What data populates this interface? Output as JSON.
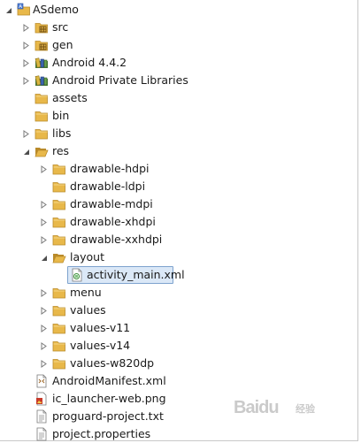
{
  "tree": {
    "nodes": [
      {
        "label": "ASdemo",
        "depth": 0,
        "toggle": "expanded",
        "icon": "project-icon",
        "selected": false
      },
      {
        "label": "src",
        "depth": 1,
        "toggle": "collapsed",
        "icon": "source-folder-icon",
        "selected": false
      },
      {
        "label": "gen",
        "depth": 1,
        "toggle": "collapsed",
        "icon": "source-folder-icon",
        "selected": false
      },
      {
        "label": "Android 4.4.2",
        "depth": 1,
        "toggle": "collapsed",
        "icon": "library-icon",
        "selected": false
      },
      {
        "label": "Android Private Libraries",
        "depth": 1,
        "toggle": "collapsed",
        "icon": "library-icon",
        "selected": false
      },
      {
        "label": "assets",
        "depth": 1,
        "toggle": "none",
        "icon": "folder-icon",
        "selected": false
      },
      {
        "label": "bin",
        "depth": 1,
        "toggle": "none",
        "icon": "folder-icon",
        "selected": false
      },
      {
        "label": "libs",
        "depth": 1,
        "toggle": "collapsed",
        "icon": "folder-icon",
        "selected": false
      },
      {
        "label": "res",
        "depth": 1,
        "toggle": "expanded",
        "icon": "open-folder-icon",
        "selected": false
      },
      {
        "label": "drawable-hdpi",
        "depth": 2,
        "toggle": "collapsed",
        "icon": "folder-icon",
        "selected": false
      },
      {
        "label": "drawable-ldpi",
        "depth": 2,
        "toggle": "none",
        "icon": "folder-icon",
        "selected": false
      },
      {
        "label": "drawable-mdpi",
        "depth": 2,
        "toggle": "collapsed",
        "icon": "folder-icon",
        "selected": false
      },
      {
        "label": "drawable-xhdpi",
        "depth": 2,
        "toggle": "collapsed",
        "icon": "folder-icon",
        "selected": false
      },
      {
        "label": "drawable-xxhdpi",
        "depth": 2,
        "toggle": "collapsed",
        "icon": "folder-icon",
        "selected": false
      },
      {
        "label": "layout",
        "depth": 2,
        "toggle": "expanded",
        "icon": "open-folder-icon",
        "selected": false
      },
      {
        "label": "activity_main.xml",
        "depth": 3,
        "toggle": "none",
        "icon": "xml-layout-file-icon",
        "selected": true
      },
      {
        "label": "menu",
        "depth": 2,
        "toggle": "collapsed",
        "icon": "folder-icon",
        "selected": false
      },
      {
        "label": "values",
        "depth": 2,
        "toggle": "collapsed",
        "icon": "folder-icon",
        "selected": false
      },
      {
        "label": "values-v11",
        "depth": 2,
        "toggle": "collapsed",
        "icon": "folder-icon",
        "selected": false
      },
      {
        "label": "values-v14",
        "depth": 2,
        "toggle": "collapsed",
        "icon": "folder-icon",
        "selected": false
      },
      {
        "label": "values-w820dp",
        "depth": 2,
        "toggle": "collapsed",
        "icon": "folder-icon",
        "selected": false
      },
      {
        "label": "AndroidManifest.xml",
        "depth": 1,
        "toggle": "none",
        "icon": "manifest-file-icon",
        "selected": false
      },
      {
        "label": "ic_launcher-web.png",
        "depth": 1,
        "toggle": "none",
        "icon": "image-file-icon",
        "selected": false
      },
      {
        "label": "proguard-project.txt",
        "depth": 1,
        "toggle": "none",
        "icon": "text-file-icon",
        "selected": false
      },
      {
        "label": "project.properties",
        "depth": 1,
        "toggle": "none",
        "icon": "text-file-icon",
        "selected": false
      }
    ]
  },
  "watermark": {
    "text": "Baidu",
    "subtext": "经验"
  },
  "colors": {
    "folder": "#e8b84a",
    "folder_dark": "#b98a2a",
    "selection_bg": "#dbe8f7",
    "selection_border": "#7da2ce",
    "toggle": "#7a7a7a"
  }
}
